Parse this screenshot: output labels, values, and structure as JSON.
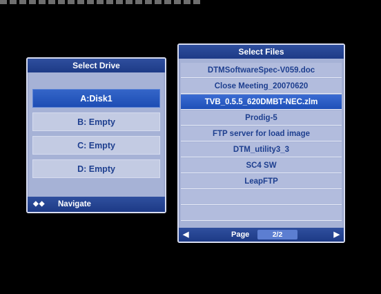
{
  "drive_panel": {
    "title": "Select Drive",
    "drives": [
      {
        "label": "A:Disk1",
        "selected": true
      },
      {
        "label": "B: Empty",
        "selected": false
      },
      {
        "label": "C: Empty",
        "selected": false
      },
      {
        "label": "D: Empty",
        "selected": false
      }
    ],
    "footer": {
      "arrows": "◆◆",
      "label": "Navigate"
    }
  },
  "files_panel": {
    "title": "Select Files",
    "files": [
      {
        "label": "DTMSoftwareSpec-V059.doc",
        "selected": false
      },
      {
        "label": "Close Meeting_20070620",
        "selected": false
      },
      {
        "label": "TVB_0.5.5_620DMBT-NEC.zlm",
        "selected": true
      },
      {
        "label": "Prodig-5",
        "selected": false
      },
      {
        "label": "FTP server for load image",
        "selected": false
      },
      {
        "label": "DTM_utility3_3",
        "selected": false
      },
      {
        "label": "SC4 SW",
        "selected": false
      },
      {
        "label": "LeapFTP",
        "selected": false
      },
      {
        "label": "",
        "selected": false
      },
      {
        "label": "",
        "selected": false
      }
    ],
    "pager": {
      "prev": "◀",
      "label": "Page",
      "value": "2/2",
      "next": "▶"
    }
  },
  "colors": {
    "accent": "#1d3a86",
    "selected": "#2b5bc4",
    "panel": "#a6b2d6",
    "text": "#1e3f8f"
  }
}
